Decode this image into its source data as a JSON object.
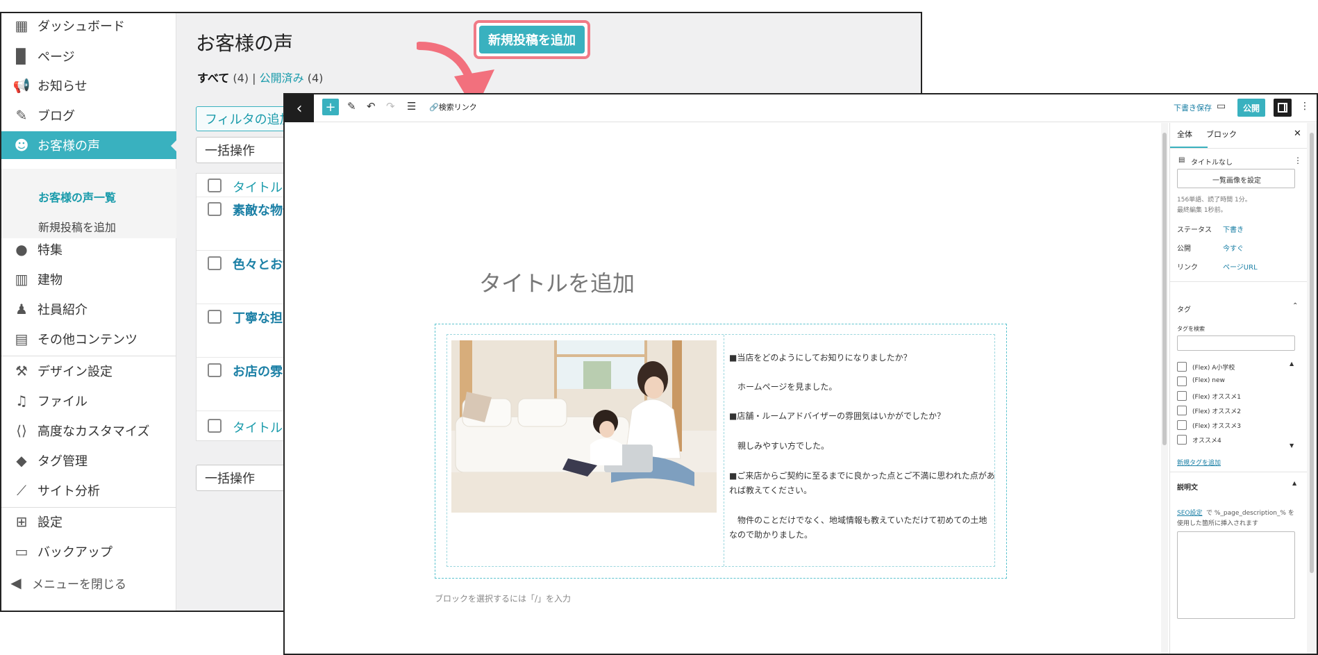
{
  "sidebar": {
    "items": [
      {
        "label": "ダッシュボード",
        "icon": "dashboard-icon"
      },
      {
        "label": "ページ",
        "icon": "pages-icon"
      },
      {
        "label": "お知らせ",
        "icon": "megaphone-icon"
      },
      {
        "label": "ブログ",
        "icon": "pen-icon"
      },
      {
        "label": "お客様の声",
        "icon": "people-icon"
      },
      {
        "label": "特集",
        "icon": "lightbulb-icon"
      },
      {
        "label": "建物",
        "icon": "building-icon"
      },
      {
        "label": "社員紹介",
        "icon": "person-icon"
      },
      {
        "label": "その他コンテンツ",
        "icon": "document-icon"
      },
      {
        "label": "デザイン設定",
        "icon": "hammer-icon"
      },
      {
        "label": "ファイル",
        "icon": "media-icon"
      },
      {
        "label": "高度なカスタマイズ",
        "icon": "code-icon"
      },
      {
        "label": "タグ管理",
        "icon": "tag-icon"
      },
      {
        "label": "サイト分析",
        "icon": "chart-icon"
      },
      {
        "label": "設定",
        "icon": "settings-icon"
      },
      {
        "label": "バックアップ",
        "icon": "archive-icon"
      }
    ],
    "submenu": [
      "お客様の声一覧",
      "新規投稿を追加"
    ],
    "collapse_label": "メニューを閉じる"
  },
  "list": {
    "page_title": "お客様の声",
    "add_button": "新規投稿を追加",
    "filter_all": "すべて",
    "filter_all_count": "(4)",
    "filter_sep": "|",
    "filter_published": "公開済み",
    "filter_published_count": "(4)",
    "filter_button": "フィルタの追加",
    "bulk_action": "一括操作",
    "column_title": "タイトル",
    "rows": [
      "素敵な物件",
      "色々とお世",
      "丁寧な担当",
      "お店の雰囲"
    ]
  },
  "editor": {
    "toolbar": {
      "link_label": "検索リンク",
      "save_draft": "下書き保存",
      "publish": "公開"
    },
    "title_placeholder": "タイトルを追加",
    "qa_lines": [
      "■当店をどのようにしてお知りになりましたか？",
      "",
      "　ホームページを見ました。",
      "",
      "■店舗・ルームアドバイザーの雰囲気はいかがでしたか？",
      "",
      "　親しみやすい方でした。",
      "",
      "■ご来店からご契約に至るまでに良かった点とご不満に思われた点があ",
      "れば教えてください。",
      "",
      "　物件のことだけでなく、地域情報も教えていただけて初めての土地",
      "なので助かりました。"
    ],
    "block_hint": "ブロックを選択するには「/」を入力"
  },
  "inspector": {
    "tab_post": "全体",
    "tab_block": "ブロック",
    "doc_title": "タイトルなし",
    "featured_image_button": "一覧画像を設定",
    "word_count": "156単語、読了時間 1分。",
    "last_edited": "最終編集 1秒前。",
    "status_label": "ステータス",
    "status_value": "下書き",
    "publish_label": "公開",
    "publish_value": "今すぐ",
    "link_label": "リンク",
    "link_value": "ページURL",
    "tags_section": "タグ",
    "tag_search_label": "タグを検索",
    "tags": [
      "(Flex) A小学校",
      "(Flex) new",
      "(Flex) オススメ1",
      "(Flex) オススメ2",
      "(Flex) オススメ3",
      "オススメ4"
    ],
    "new_tag_link": "新規タグを追加",
    "description_section": "説明文",
    "seo_link": "SEO設定",
    "seo_note_1": "で %_page_description_% を",
    "seo_note_2": "使用した箇所に挿入されます"
  },
  "colors": {
    "accent": "#39b1bf",
    "highlight_border": "#f07a86",
    "arrow": "#f2707d"
  }
}
